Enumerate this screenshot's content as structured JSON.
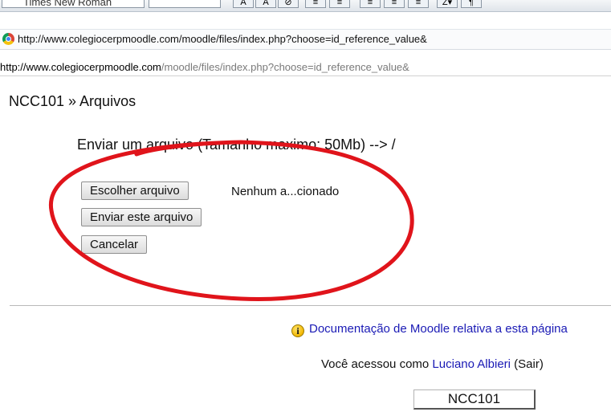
{
  "toolbar": {
    "font_name": "Times New Roman",
    "buttons": [
      "A",
      "A",
      "⊘",
      "≡",
      "≡",
      "≡",
      "≡",
      "≡",
      "Z▾",
      "¶"
    ]
  },
  "browser": {
    "address_url": "http://www.colegiocerpmoodle.com/moodle/files/index.php?choose=id_reference_value&",
    "page_url_host": "http://www.colegiocerpmoodle.com",
    "page_url_path": "/moodle/files/index.php?choose=id_reference_value&"
  },
  "page": {
    "breadcrumb": "NCC101 » Arquivos",
    "upload_title": "Enviar um arquivo (Tamanho maximo: 50Mb) --> /",
    "choose_file_label": "Escolher arquivo",
    "file_status": "Nenhum a...cionado",
    "send_button_label": "Enviar este arquivo",
    "cancel_button_label": "Cancelar"
  },
  "footer": {
    "doc_link": "Documentação de Moodle relativa a esta página",
    "login_prefix": "Você acessou como ",
    "user_link": "Luciano Albieri",
    "login_suffix": " (Sair)",
    "course_button": "NCC101"
  },
  "annotation": {
    "color": "#e0141b"
  }
}
